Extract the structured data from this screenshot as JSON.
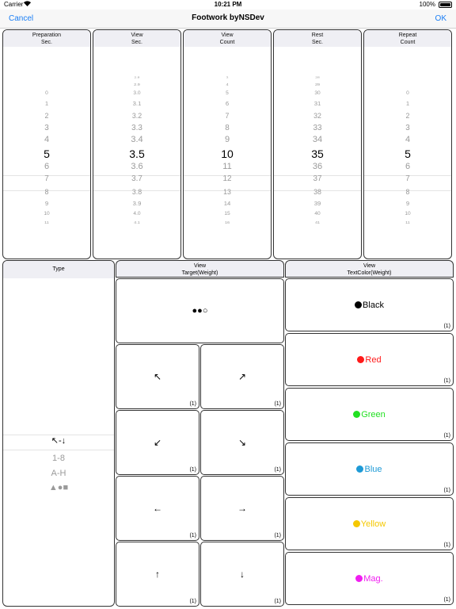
{
  "status_bar": {
    "carrier": "Carrier",
    "time": "10:21 PM",
    "battery": "100%"
  },
  "nav": {
    "cancel": "Cancel",
    "title": "Footwork byNSDev",
    "ok": "OK"
  },
  "pickers": [
    {
      "id": "preparation",
      "title1": "Preparation",
      "title2": "Sec.",
      "selected": "5",
      "above": [
        "0",
        "1",
        "2",
        "3",
        "4"
      ],
      "below": [
        "6",
        "7",
        "8",
        "9",
        "10",
        "11"
      ]
    },
    {
      "id": "view-sec",
      "title1": "View",
      "title2": "Sec.",
      "selected": "3.5",
      "above": [
        "2.8",
        "2.9",
        "3.0",
        "3.1",
        "3.2",
        "3.3",
        "3.4"
      ],
      "below": [
        "3.6",
        "3.7",
        "3.8",
        "3.9",
        "4.0",
        "4.1"
      ]
    },
    {
      "id": "view-count",
      "title1": "View",
      "title2": "Count",
      "selected": "10",
      "above": [
        "3",
        "4",
        "5",
        "6",
        "7",
        "8",
        "9"
      ],
      "below": [
        "11",
        "12",
        "13",
        "14",
        "15",
        "16"
      ]
    },
    {
      "id": "rest-sec",
      "title1": "Rest",
      "title2": "Sec.",
      "selected": "35",
      "above": [
        "28",
        "29",
        "30",
        "31",
        "32",
        "33",
        "34"
      ],
      "below": [
        "36",
        "37",
        "38",
        "39",
        "40",
        "41"
      ]
    },
    {
      "id": "repeat-count",
      "title1": "Repeat",
      "title2": "Count",
      "selected": "5",
      "above": [
        "0",
        "1",
        "2",
        "3",
        "4"
      ],
      "below": [
        "6",
        "7",
        "8",
        "9",
        "10",
        "11"
      ]
    }
  ],
  "type_panel": {
    "title": "Type",
    "options": [
      "↖-↓",
      "1-8",
      "A-H",
      "▲●■"
    ],
    "selected_index": 0
  },
  "target_panel": {
    "title1": "View",
    "title2": "Target(Weight)",
    "top_glyph": "●●○",
    "cells": [
      {
        "glyph": "↖",
        "weight": "(1)"
      },
      {
        "glyph": "↗",
        "weight": "(1)"
      },
      {
        "glyph": "↙",
        "weight": "(1)"
      },
      {
        "glyph": "↘",
        "weight": "(1)"
      },
      {
        "glyph": "←",
        "weight": "(1)"
      },
      {
        "glyph": "→",
        "weight": "(1)"
      },
      {
        "glyph": "↑",
        "weight": "(1)"
      },
      {
        "glyph": "↓",
        "weight": "(1)"
      }
    ]
  },
  "color_panel": {
    "title1": "View",
    "title2": "TextColor(Weight)",
    "items": [
      {
        "label": "Black",
        "color": "#000000",
        "weight": "(1)"
      },
      {
        "label": "Red",
        "color": "#ff1a1a",
        "weight": "(1)"
      },
      {
        "label": "Green",
        "color": "#22e022",
        "weight": "(1)"
      },
      {
        "label": "Blue",
        "color": "#1e9ad6",
        "weight": "(1)"
      },
      {
        "label": "Yellow",
        "color": "#f5c800",
        "weight": "(1)"
      },
      {
        "label": "Mag.",
        "color": "#f01ef0",
        "weight": "(1)"
      }
    ]
  }
}
